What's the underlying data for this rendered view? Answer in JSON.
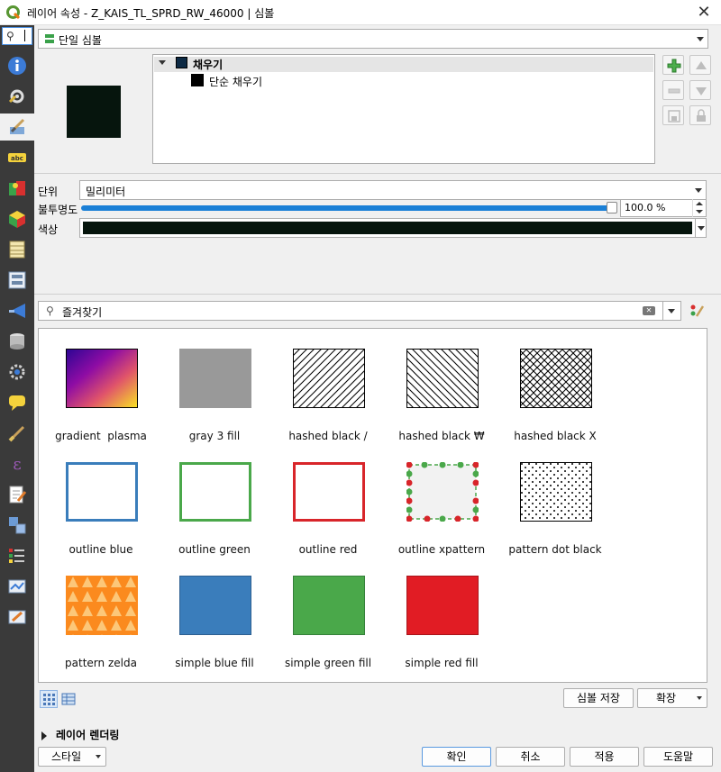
{
  "window": {
    "title": "레이어 속성 - Z_KAIS_TL_SPRD_RW_46000 | 심볼"
  },
  "renderer": {
    "type_label": "단일 심볼"
  },
  "symbol_tree": {
    "root_label": "채우기",
    "child_label": "단순 채우기"
  },
  "unit": {
    "label": "단위",
    "value": "밀리미터"
  },
  "opacity": {
    "label": "불투명도",
    "value_text": "100.0 %",
    "value": 100
  },
  "color": {
    "label": "색상",
    "value": "#06150d"
  },
  "search": {
    "placeholder": "즐겨찾기"
  },
  "symbols": [
    {
      "name": "gradient  plasma"
    },
    {
      "name": "gray 3 fill"
    },
    {
      "name": "hashed black /"
    },
    {
      "name": "hashed black ₩"
    },
    {
      "name": "hashed black X"
    },
    {
      "name": "outline blue"
    },
    {
      "name": "outline green"
    },
    {
      "name": "outline red"
    },
    {
      "name": "outline xpattern"
    },
    {
      "name": "pattern dot black"
    },
    {
      "name": "pattern zelda"
    },
    {
      "name": "simple blue fill"
    },
    {
      "name": "simple green fill"
    },
    {
      "name": "simple red fill"
    }
  ],
  "gallery_actions": {
    "save_label": "심볼 저장",
    "advanced_label": "확장"
  },
  "layer_rendering": {
    "label": "레이어 렌더링"
  },
  "footer": {
    "style_label": "스타일",
    "ok_label": "확인",
    "cancel_label": "취소",
    "apply_label": "적용",
    "help_label": "도움말"
  }
}
